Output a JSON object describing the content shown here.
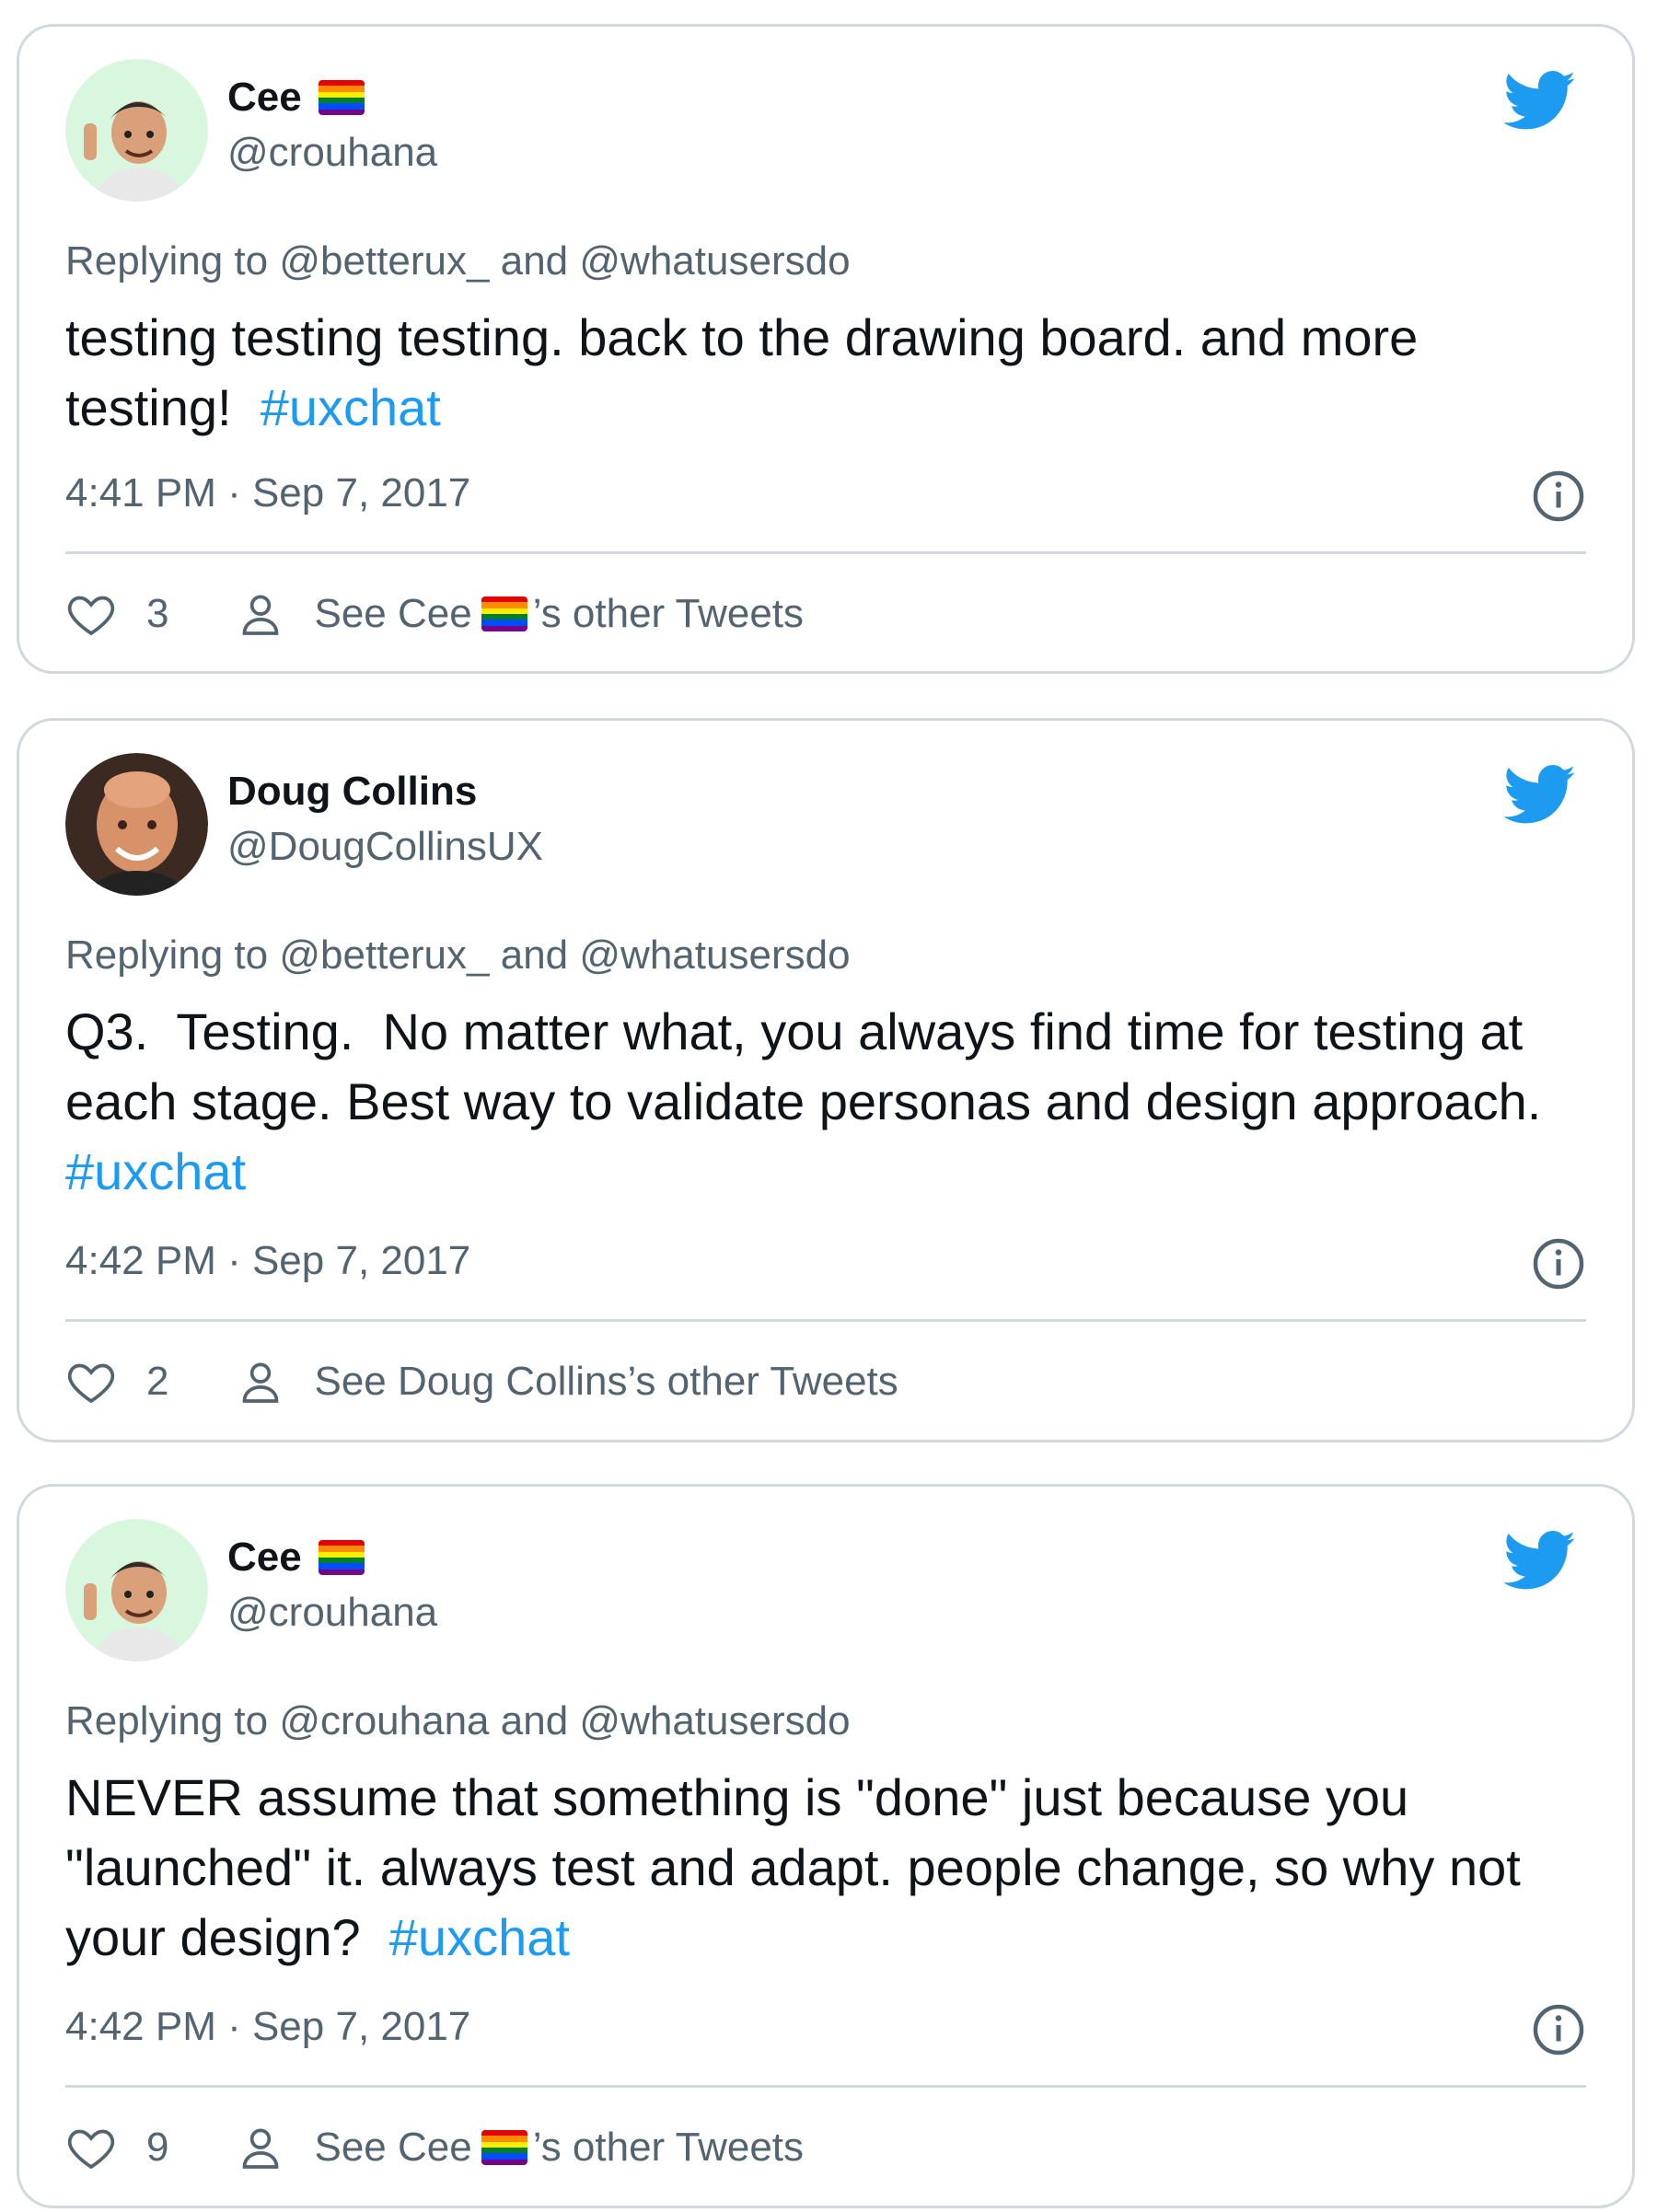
{
  "colors": {
    "accent": "#1d9bf0",
    "text": "#0f1419",
    "secondary": "#536471",
    "border": "#cfd9de"
  },
  "tweets": [
    {
      "author_name": "Cee",
      "author_flag": "rainbow-flag-icon",
      "handle": "@crouhana",
      "replying_prefix": "Replying to",
      "replying_first": "@betterux_",
      "replying_and": "and",
      "replying_second": "@whatusersdo",
      "text": "testing testing testing. back to the drawing board. and more testing!  ",
      "hashtag": "#uxchat",
      "timestamp": "4:41 PM · Sep 7, 2017",
      "likes": "3",
      "other_tweets_prefix": "See Cee",
      "other_tweets_suffix": "’s other Tweets"
    },
    {
      "author_name": "Doug Collins",
      "handle": "@DougCollinsUX",
      "replying_prefix": "Replying to",
      "replying_first": "@betterux_",
      "replying_and": "and",
      "replying_second": "@whatusersdo",
      "text": "Q3.  Testing.  No matter what, you always find time for testing at each stage. Best way to validate personas and design approach.  ",
      "hashtag": "#uxchat",
      "timestamp": "4:42 PM · Sep 7, 2017",
      "likes": "2",
      "other_tweets_prefix": "See Doug Collins’s other Tweets",
      "other_tweets_suffix": ""
    },
    {
      "author_name": "Cee",
      "author_flag": "rainbow-flag-icon",
      "handle": "@crouhana",
      "replying_prefix": "Replying to",
      "replying_first": "@crouhana",
      "replying_and": "and",
      "replying_second": "@whatusersdo",
      "text": "NEVER assume that something is \"done\" just because you \"launched\" it. always test and adapt. people change, so why not your design?  ",
      "hashtag": "#uxchat",
      "timestamp": "4:42 PM · Sep 7, 2017",
      "likes": "9",
      "other_tweets_prefix": "See Cee",
      "other_tweets_suffix": "’s other Tweets"
    }
  ]
}
